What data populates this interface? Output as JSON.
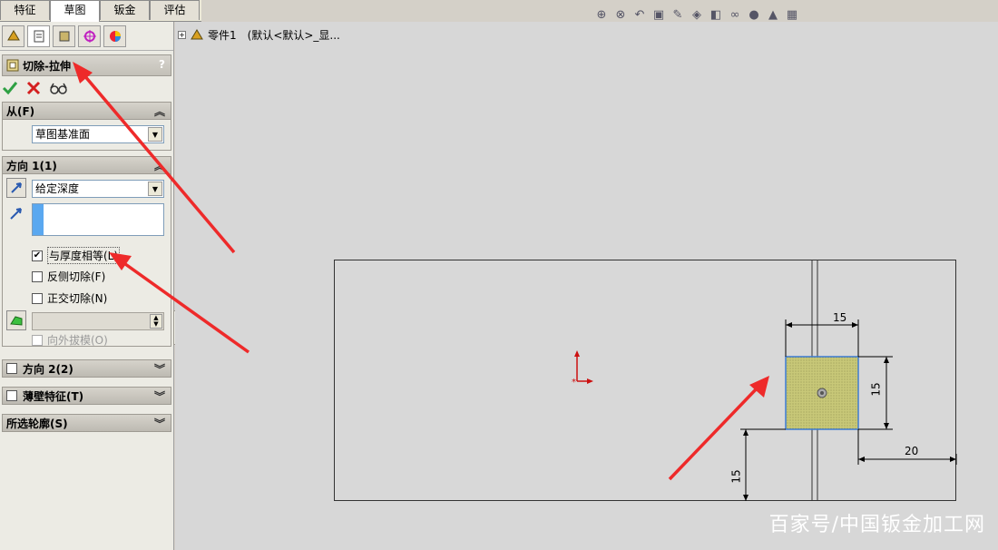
{
  "tabs": [
    "特征",
    "草图",
    "钣金",
    "评估"
  ],
  "feature": {
    "title": "切除-拉伸",
    "help": "?"
  },
  "from": {
    "header": "从(F)",
    "value": "草图基准面"
  },
  "direction1": {
    "header": "方向 1(1)",
    "end_condition": "给定深度",
    "equal_thickness": "与厚度相等(L)",
    "flip_side": "反侧切除(F)",
    "normal_cut": "正交切除(N)",
    "draft_outward": "向外拔模(O)"
  },
  "groups": {
    "direction2": "方向 2(2)",
    "thin": "薄壁特征(T)",
    "contours": "所选轮廓(S)"
  },
  "tree": {
    "part": "零件1",
    "config": "(默认<默认>_显..."
  },
  "dimensions": {
    "width": "15",
    "height": "15",
    "offset_x": "20",
    "offset_y": "15"
  },
  "watermark": "百家号/中国钣金加工网",
  "colors": {
    "accent_green": "#2ea043",
    "cancel_red": "#d42020",
    "arrow_red": "#ee2a2a",
    "sketch_blue": "#3a7bd5",
    "fill_yellow": "#c8c878"
  }
}
